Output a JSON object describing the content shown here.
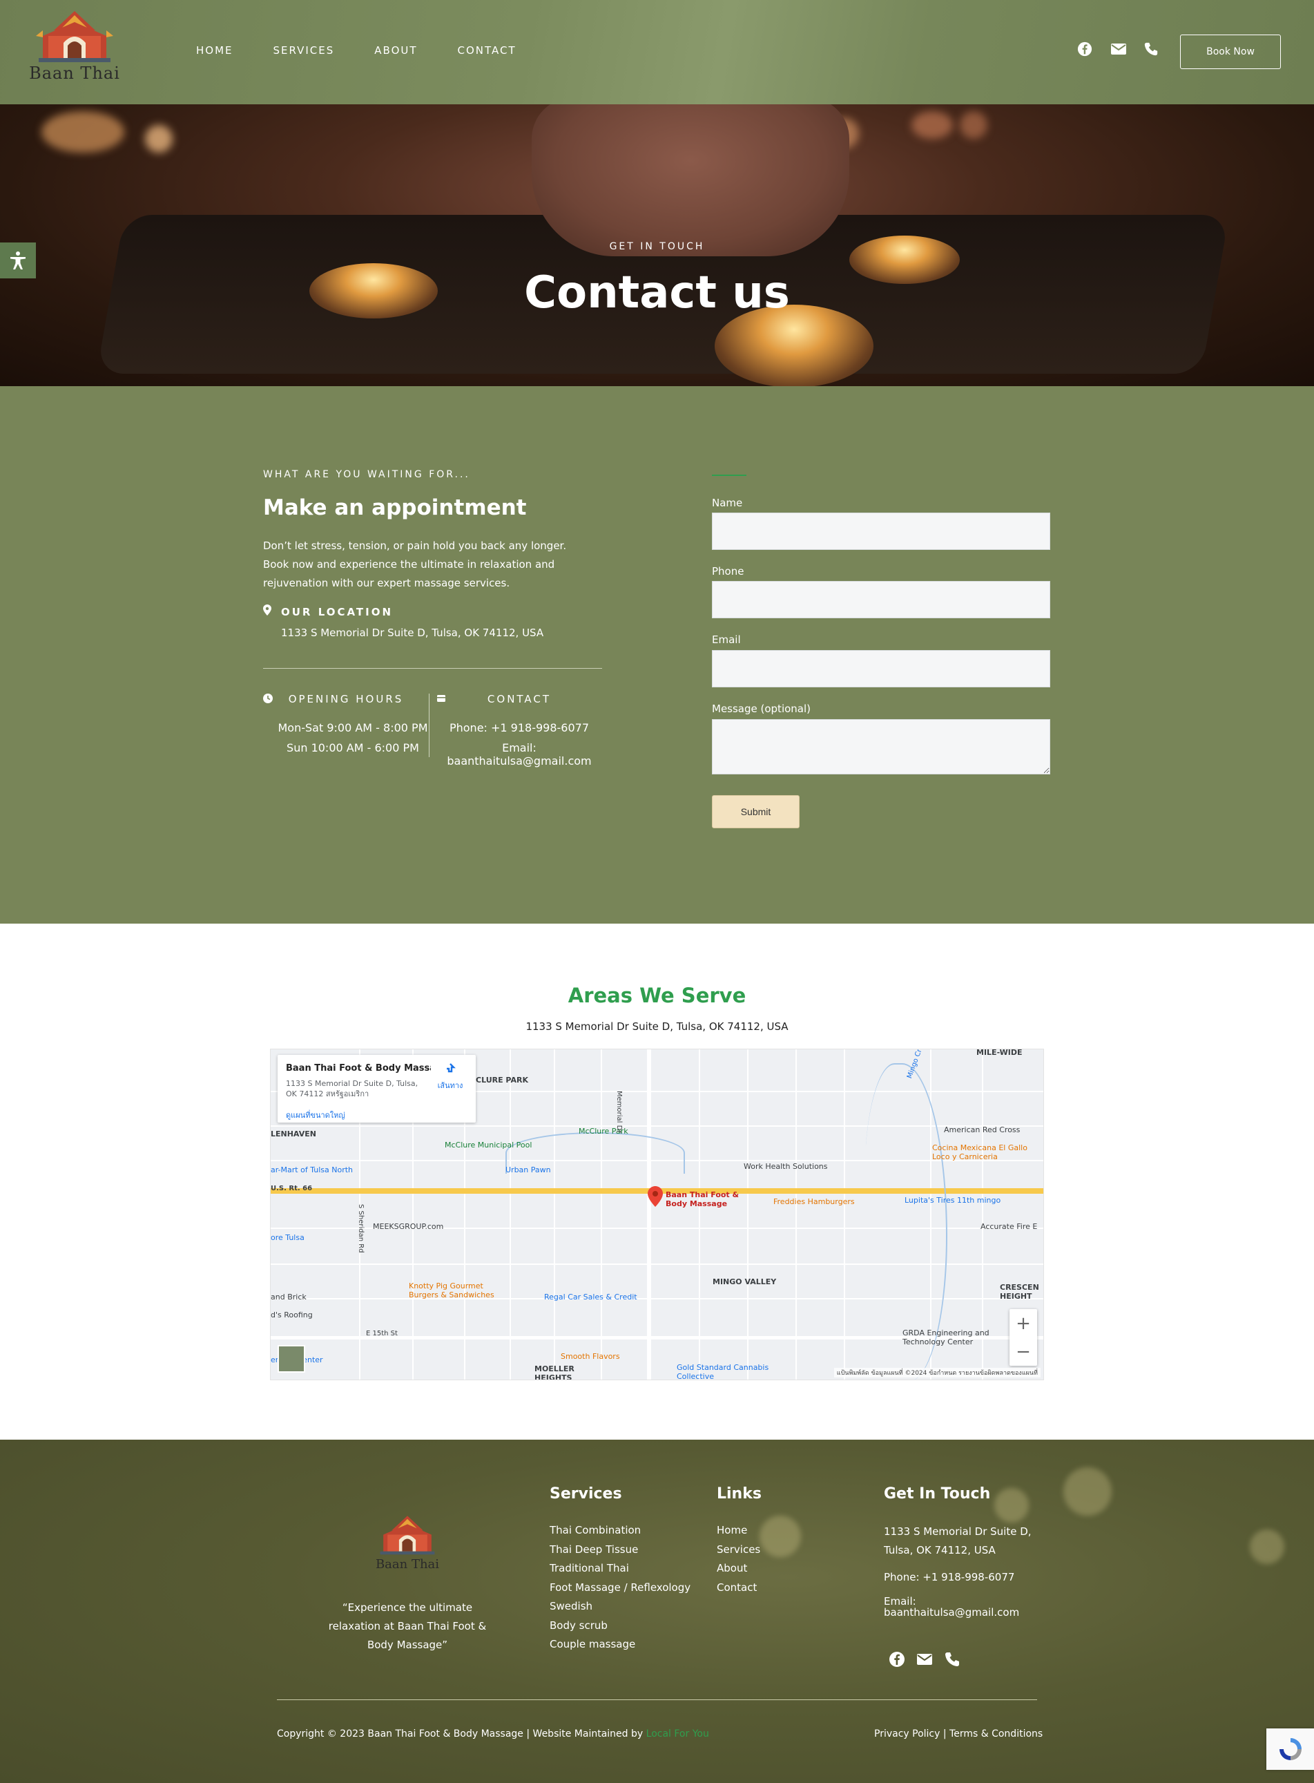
{
  "header": {
    "logo_text": "Baan Thai",
    "nav": [
      {
        "label": "HOME"
      },
      {
        "label": "SERVICES"
      },
      {
        "label": "ABOUT"
      },
      {
        "label": "CONTACT"
      }
    ],
    "icons": [
      "facebook-icon",
      "envelope-icon",
      "phone-icon"
    ],
    "book_label": "Book Now"
  },
  "hero": {
    "eyebrow": "GET IN TOUCH",
    "title": "Contact us"
  },
  "appointment": {
    "eyebrow": "WHAT ARE YOU WAITING FOR...",
    "title": "Make an appointment",
    "description": "Don’t let stress, tension, or pain hold you back any longer. Book now and experience the ultimate in relaxation and rejuvenation with our expert massage services.",
    "location_label": "OUR LOCATION",
    "location_address": "1133 S Memorial Dr Suite D, Tulsa, OK 74112, USA",
    "hours_label": "OPENING HOURS",
    "hours_line1": "Mon-Sat 9:00 AM - 8:00 PM",
    "hours_line2": "Sun 10:00 AM - 6:00 PM",
    "contact_label": "CONTACT",
    "contact_phone": "Phone: +1 918-998-6077",
    "contact_email": "Email: baanthaitulsa@gmail.com"
  },
  "form": {
    "name_label": "Name",
    "name_value": "",
    "phone_label": "Phone",
    "phone_value": "",
    "email_label": "Email",
    "email_value": "",
    "message_label": "Message (optional)",
    "message_value": "",
    "submit_label": "Submit"
  },
  "areas": {
    "title": "Areas We Serve",
    "address": "1133 S Memorial Dr Suite D, Tulsa, OK 74112, USA",
    "map": {
      "card_title": "Baan Thai Foot & Body Massa...",
      "card_address": "1133 S Memorial Dr Suite D, Tulsa, OK 74112 สหรัฐอเมริกา",
      "card_link": "ดูแผนที่ขนาดใหญ่",
      "card_directions": "เส้นทาง",
      "pin_label": "Baan Thai Foot & Body Massage",
      "labels": [
        "MILE-WIDE",
        "CLURE PARK",
        "LENHAVEN",
        "McClure Municipal Pool",
        "McClure Park",
        "ar-Mart of Tulsa North",
        "Urban Pawn",
        "Work Health Solutions",
        "American Red Cross",
        "Cocina Mexicana El Gallo Loco y Carniceria",
        "U.S. Rt. 66",
        "Freddies Hamburgers",
        "Lupita's Tires 11th mingo",
        "MEEKSGROUP.com",
        "Accurate Fire E",
        "ore Tulsa",
        "Knotty Pig Gourmet Burgers & Sandwiches",
        "Regal Car Sales & Credit",
        "MINGO VALLEY",
        "CRESCEN HEIGHT",
        "and Brick",
        "d's Roofing",
        "GRDA Engineering and Technology Center",
        "eridan Center",
        "Smooth Flavors",
        "MOELLER HEIGHTS",
        "Gold Standard Cannabis Collective",
        "Memorial Dr",
        "S Sheridan Rd",
        "E 15th St",
        "Mingo Creek"
      ],
      "zoom_in": "+",
      "zoom_out": "−",
      "footer_text": "แป้นพิมพ์ลัด   ข้อมูลแผนที่ ©2024   ข้อกำหนด   รายงานข้อผิดพลาดของแผนที่"
    }
  },
  "footer": {
    "logo_text": "Baan Thai",
    "tagline": "“Experience the ultimate relaxation at Baan Thai Foot & Body Massage”",
    "services_title": "Services",
    "services": [
      "Thai Combination",
      "Thai Deep Tissue",
      "Traditional Thai",
      "Foot Massage / Reflexology",
      "Swedish",
      "Body scrub",
      "Couple massage"
    ],
    "links_title": "Links",
    "links": [
      "Home",
      "Services",
      "About",
      "Contact"
    ],
    "contact_title": "Get In Touch",
    "contact_address": "1133 S Memorial Dr Suite D, Tulsa, OK 74112, USA",
    "contact_phone": "Phone: +1 918-998-6077",
    "contact_email_label": "Email:",
    "contact_email": "baanthaitulsa@gmail.com",
    "copyright": "Copyright © 2023 Baan Thai Foot & Body Massage | Website Maintained by",
    "maintainer": "Local For You",
    "privacy": "Privacy Policy",
    "separator": "|",
    "terms": "Terms & Conditions"
  },
  "colors": {
    "header_green": "#788558",
    "section_green": "#788558",
    "accent_green": "#2f9e4e",
    "submit_bg": "#f3e2c0",
    "footer_olive": "#575a33"
  }
}
